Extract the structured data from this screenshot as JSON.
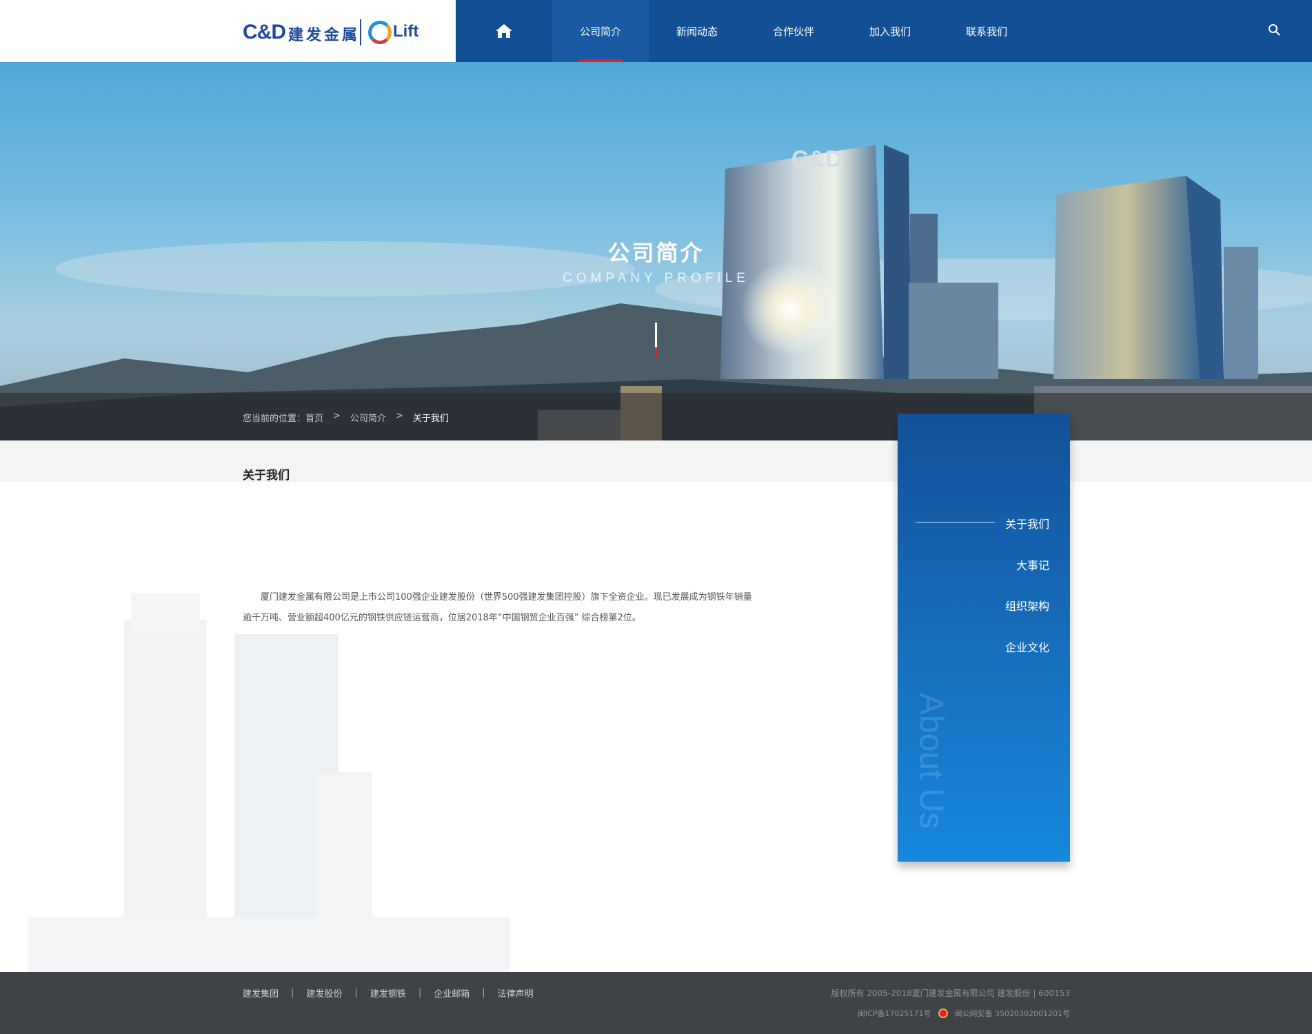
{
  "brand": {
    "logo_mark": "C&D",
    "logo_name": "建发金属",
    "partner_logo": "Lift"
  },
  "nav": {
    "home_icon": "home-icon",
    "items": [
      "公司简介",
      "新闻动态",
      "合作伙伴",
      "加入我们",
      "联系我们"
    ],
    "active_index": 0,
    "search_icon": "search-icon"
  },
  "banner": {
    "title": "公司简介",
    "subtitle": "COMPANY PROFILE",
    "building_sign": "C&D"
  },
  "breadcrumb": {
    "prefix": "您当前的位置：首页",
    "sep": ">",
    "level1": "公司简介",
    "current": "关于我们"
  },
  "content": {
    "section_title": "关于我们",
    "paragraph": "厦门建发金属有限公司是上市公司100强企业建发股份（世界500强建发集团控股）旗下全资企业。现已发展成为钢铁年销量逾千万吨、营业额超400亿元的钢铁供应链运营商，位居2018年“中国钢贸企业百强” 综合榜第2位。"
  },
  "side_menu": {
    "items": [
      "关于我们",
      "大事记",
      "组织架构",
      "企业文化"
    ],
    "active_index": 0,
    "watermark": "About Us"
  },
  "footer": {
    "links": [
      "建发集团",
      "建发股份",
      "建发钢铁",
      "企业邮箱",
      "法律声明"
    ],
    "separator": "|",
    "copyright": "版权所有 2005-2018厦门建发金属有限公司 建发股份 | 600153",
    "icp": "闽ICP备17025171号",
    "police": "闽公网安备 35020302001201号"
  },
  "colors": {
    "nav_bg": "#134f94",
    "accent_red": "#d8242a",
    "side_menu_top": "#13519a",
    "side_menu_bottom": "#1788dc",
    "footer_bg": "#3f4246"
  }
}
